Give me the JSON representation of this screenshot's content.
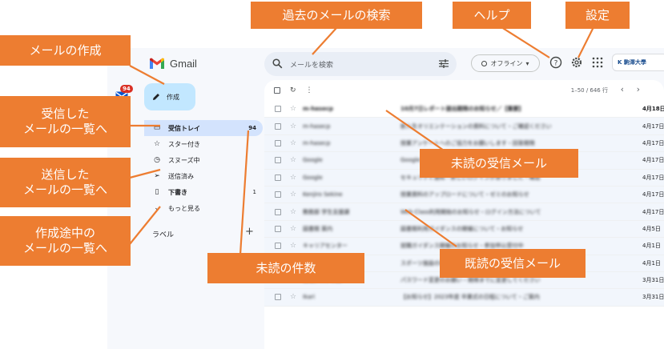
{
  "callouts": {
    "search": "過去のメールの検索",
    "help": "ヘルプ",
    "settings": "設定",
    "compose": "メールの作成",
    "inbox_line1": "受信した",
    "inbox_line2": "メールの一覧へ",
    "sent_line1": "送信した",
    "sent_line2": "メールの一覧へ",
    "drafts_line1": "作成途中の",
    "drafts_line2": "メールの一覧へ",
    "unread_count": "未読の件数",
    "unread_mail": "未読の受信メール",
    "read_mail": "既読の受信メール"
  },
  "header": {
    "app_name": "Gmail",
    "search_placeholder": "メールを検索",
    "offline_label": "オフライン",
    "org_name": "K 駒澤大學",
    "rail_badge": "94"
  },
  "compose": {
    "label": "作成"
  },
  "nav": {
    "items": [
      {
        "icon": "inbox-icon",
        "label": "受信トレイ",
        "count": "94"
      },
      {
        "icon": "star-icon",
        "label": "スター付き",
        "count": ""
      },
      {
        "icon": "clock-icon",
        "label": "スヌーズ中",
        "count": ""
      },
      {
        "icon": "send-icon",
        "label": "送信済み",
        "count": ""
      },
      {
        "icon": "draft-icon",
        "label": "下書き",
        "count": "1"
      },
      {
        "icon": "chevron-down-icon",
        "label": "もっと見る",
        "count": ""
      }
    ],
    "labels_heading": "ラベル",
    "labels_add": "+"
  },
  "toolbar": {
    "pager": "1–50 / 646 行",
    "prev": "‹",
    "next": "›"
  },
  "emails": [
    {
      "sender": "m-hasecp",
      "subject": "10月7日レポート提出期限のお知らせ／【重要】",
      "date": "4月18日",
      "unread": true
    },
    {
      "sender": "m-hasecp",
      "subject": "新入生オリエンテーションの資料について・ご確認ください",
      "date": "4月17日",
      "unread": false
    },
    {
      "sender": "m-hasecp",
      "subject": "授業アンケートへのご協力をお願いします・回答期限",
      "date": "4月17日",
      "unread": false
    },
    {
      "sender": "Google",
      "subject": "Googleアカウントのセキュリティ通知・新しいデバイス",
      "date": "4月17日",
      "unread": false
    },
    {
      "sender": "Google",
      "subject": "セキュリティ通知・新しいログインがありました・確認",
      "date": "4月17日",
      "unread": false
    },
    {
      "sender": "Kenjiro Sekine",
      "subject": "授業資料のアップロードについて・ゼミのお知らせ",
      "date": "4月17日",
      "unread": false
    },
    {
      "sender": "教務部 学生支援課",
      "subject": "Web Class利用開始のお知らせ・ログイン方法について",
      "date": "4月17日",
      "unread": false
    },
    {
      "sender": "図書館 案内",
      "subject": "図書館利用ガイダンスの開催について・お知らせ",
      "date": "4月5日",
      "unread": false
    },
    {
      "sender": "キャリアセンター",
      "subject": "就職ガイダンス開催のお知らせ・参加申込受付中",
      "date": "4月1日",
      "unread": false
    },
    {
      "sender": "学生支援センター",
      "subject": "スポーツ施設の利用開始について・予約方法のご案内",
      "date": "4月1日",
      "unread": false
    },
    {
      "sender": "情報システム課",
      "subject": "パスワード変更のお願い・期限までに変更してください",
      "date": "3月31日",
      "unread": false
    },
    {
      "sender": "Ikari",
      "subject": "【お知らせ】2023年度 卒業式の日程について・ご案内",
      "date": "3月31日",
      "unread": false
    }
  ]
}
